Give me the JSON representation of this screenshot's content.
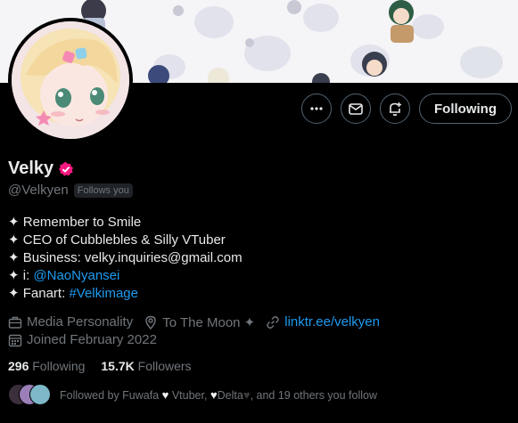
{
  "profile": {
    "name": "Velky",
    "handle": "@Velkyen",
    "follows_you": "Follows you",
    "verified_badge_color": "#f91880"
  },
  "actions": {
    "more_icon": "more-icon",
    "message_icon": "mail-icon",
    "notify_icon": "bell-plus-icon",
    "follow_label": "Following"
  },
  "bio": {
    "line1": "✦ Remember to Smile",
    "line2": "✦ CEO of Cubblebles & Silly VTuber",
    "line3": "✦ Business: velky.inquiries@gmail.com",
    "line4_prefix": "✦ i: ",
    "line4_link": "@NaoNyansei",
    "line5_prefix": "✦ Fanart: ",
    "line5_link": "#Velkimage"
  },
  "meta": {
    "category": "Media Personality",
    "location": "To The Moon ✦",
    "website": "linktr.ee/velkyen",
    "joined": "Joined February 2022"
  },
  "stats": {
    "following_count": "296",
    "following_label": "Following",
    "followers_count": "15.7K",
    "followers_label": "Followers"
  },
  "followed_by": {
    "text_part1": "Followed by Fuwafa",
    "text_part2": " Vtuber, ",
    "text_part3": "Delta",
    "text_part4": ", and 19 others you follow"
  },
  "colors": {
    "accent": "#1d9bf0",
    "muted": "#71767b",
    "background": "#000000"
  }
}
